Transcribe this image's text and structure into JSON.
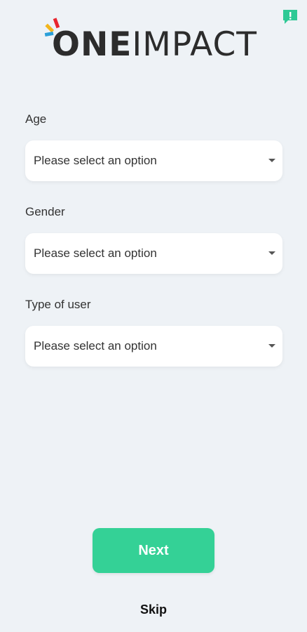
{
  "logo": {
    "part1": "ONE",
    "part2": "IMPACT"
  },
  "feedback": {
    "icon": "feedback-icon",
    "symbol": "!",
    "color": "#2ec995"
  },
  "form": {
    "age": {
      "label": "Age",
      "placeholder": "Please select an option"
    },
    "gender": {
      "label": "Gender",
      "placeholder": "Please select an option"
    },
    "user_type": {
      "label": "Type of user",
      "placeholder": "Please select an option"
    }
  },
  "actions": {
    "next_label": "Next",
    "skip_label": "Skip"
  },
  "colors": {
    "background": "#eef2f6",
    "accent": "#34d196"
  }
}
